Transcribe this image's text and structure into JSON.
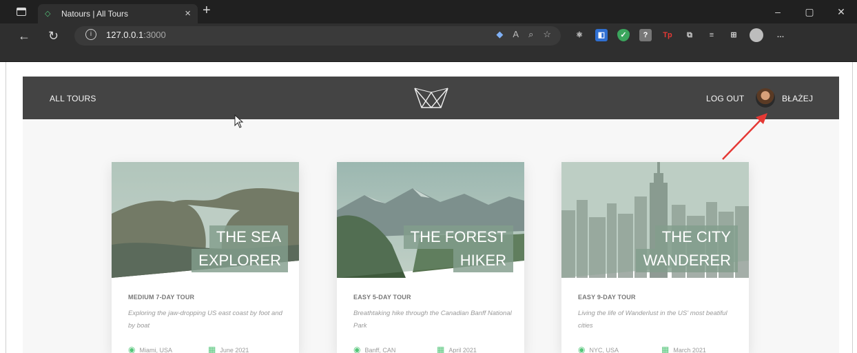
{
  "browser": {
    "tab_title": "Natours | All Tours",
    "url_host": "127.0.0.1",
    "url_port": ":3000"
  },
  "site": {
    "nav_all_tours": "ALL TOURS",
    "nav_logout": "LOG OUT",
    "user_name": "BŁAŻEJ"
  },
  "cards": [
    {
      "heading_line1": "THE SEA",
      "heading_line2": "EXPLORER",
      "subheading": "MEDIUM 7-DAY TOUR",
      "summary": "Exploring the jaw-dropping US east coast by foot and by boat",
      "location": "Miami, USA",
      "date": "June 2021"
    },
    {
      "heading_line1": "THE FOREST",
      "heading_line2": "HIKER",
      "subheading": "EASY 5-DAY TOUR",
      "summary": "Breathtaking hike through the Canadian Banff National Park",
      "location": "Banff, CAN",
      "date": "April 2021"
    },
    {
      "heading_line1": "THE CITY",
      "heading_line2": "WANDERER",
      "subheading": "EASY 9-DAY TOUR",
      "summary": "Living the life of Wanderlust in the US' most beatiful cities",
      "location": "NYC, USA",
      "date": "March 2021"
    }
  ],
  "colors": {
    "accent": "#55c57a",
    "header_bg": "#444444",
    "annotation_arrow": "#e53935"
  }
}
